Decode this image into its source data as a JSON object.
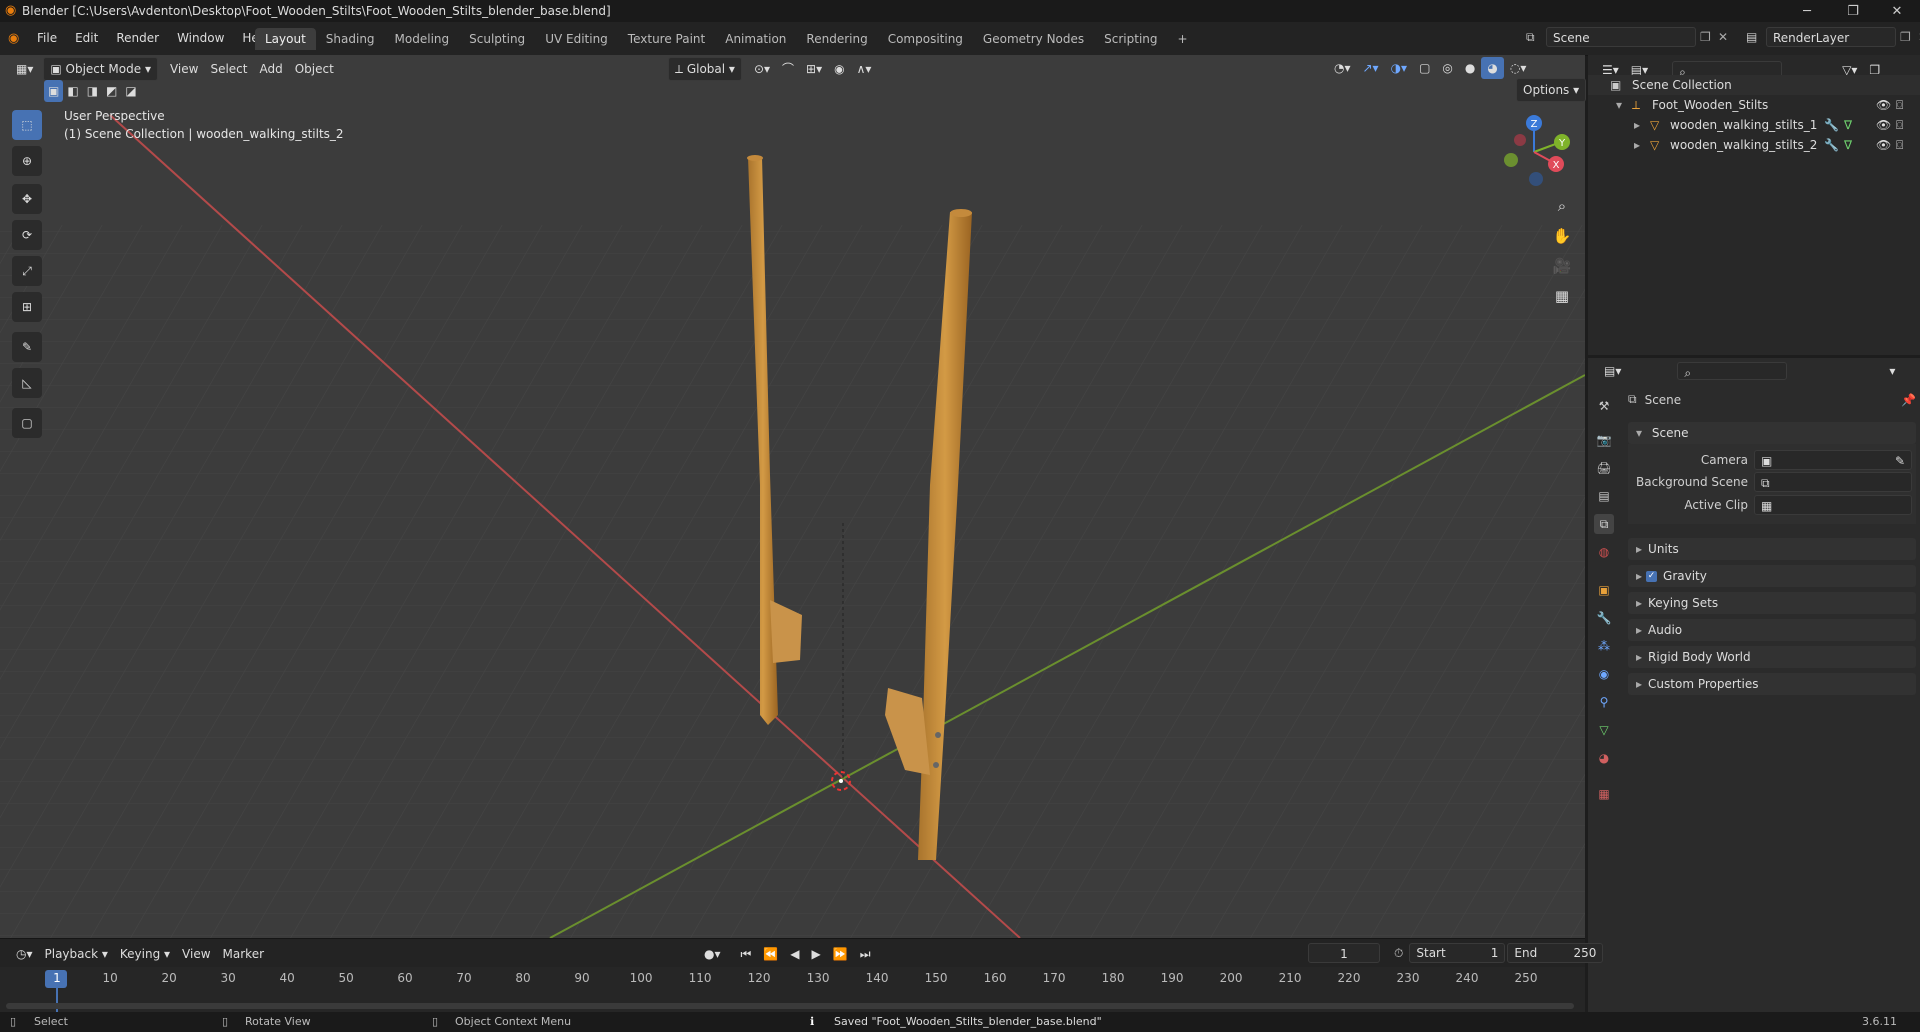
{
  "window": {
    "title": "Blender [C:\\Users\\Avdenton\\Desktop\\Foot_Wooden_Stilts\\Foot_Wooden_Stilts_blender_base.blend]",
    "minimize": "─",
    "maximize": "❐",
    "close": "✕"
  },
  "menu": [
    "File",
    "Edit",
    "Render",
    "Window",
    "Help"
  ],
  "workspaces": [
    "Layout",
    "Shading",
    "Modeling",
    "Sculpting",
    "UV Editing",
    "Texture Paint",
    "Animation",
    "Rendering",
    "Compositing",
    "Geometry Nodes",
    "Scripting"
  ],
  "workspace_add": "+",
  "scene_field": "Scene",
  "renderlayer_field": "RenderLayer",
  "viewport_header": {
    "mode": "Object Mode",
    "menus": [
      "View",
      "Select",
      "Add",
      "Object"
    ],
    "transform": "Global",
    "options": "Options"
  },
  "viewport_overlay": {
    "line1": "User Perspective",
    "line2": "(1) Scene Collection | wooden_walking_stilts_2"
  },
  "gizmo": {
    "z": "Z",
    "y": "Y",
    "x": "X"
  },
  "outliner": {
    "root": "Scene Collection",
    "collection": "Foot_Wooden_Stilts",
    "objects": [
      "wooden_walking_stilts_1",
      "wooden_walking_stilts_2"
    ]
  },
  "properties": {
    "context": "Scene",
    "panel": "Scene",
    "fields": [
      {
        "label": "Camera",
        "value": ""
      },
      {
        "label": "Background Scene",
        "value": ""
      },
      {
        "label": "Active Clip",
        "value": ""
      }
    ],
    "sections": [
      "Units",
      "Gravity",
      "Keying Sets",
      "Audio",
      "Rigid Body World",
      "Custom Properties"
    ],
    "gravity_checked": true
  },
  "timeline": {
    "menus": [
      "Playback",
      "Keying",
      "View",
      "Marker"
    ],
    "current_frame": "1",
    "start_label": "Start",
    "start": "1",
    "end_label": "End",
    "end": "250",
    "ticks": [
      "1",
      "10",
      "20",
      "30",
      "40",
      "50",
      "60",
      "70",
      "80",
      "90",
      "100",
      "110",
      "120",
      "130",
      "140",
      "150",
      "160",
      "170",
      "180",
      "190",
      "200",
      "210",
      "220",
      "230",
      "240",
      "250"
    ]
  },
  "statusbar": {
    "select": "Select",
    "rotate": "Rotate View",
    "context": "Object Context Menu",
    "message": "Saved \"Foot_Wooden_Stilts_blender_base.blend\"",
    "version": "3.6.11"
  }
}
